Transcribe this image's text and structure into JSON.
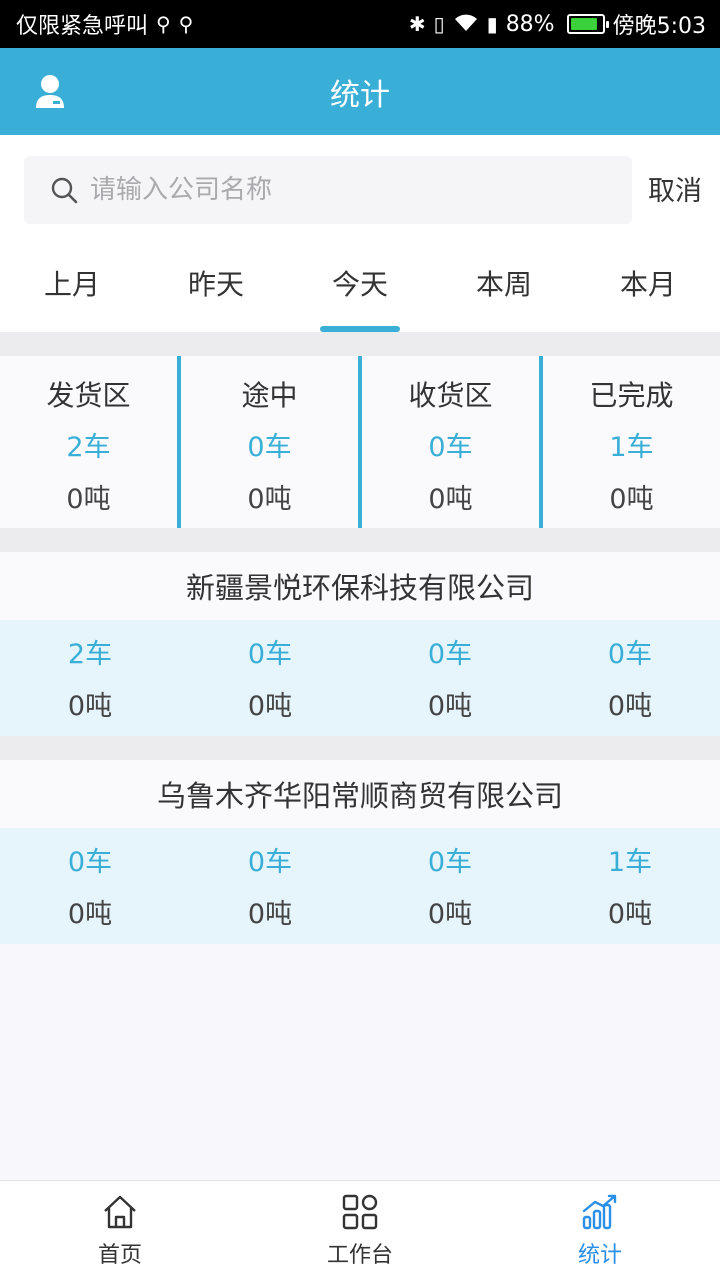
{
  "status_bar": {
    "left_text": "仅限紧急呼叫",
    "battery": "88%",
    "time": "傍晚5:03",
    "battery_level": 0.88
  },
  "header": {
    "title": "统计",
    "user_icon": "user-icon"
  },
  "search": {
    "placeholder": "请输入公司名称",
    "value": "",
    "cancel_label": "取消"
  },
  "tabs": [
    {
      "label": "上月",
      "active": false
    },
    {
      "label": "昨天",
      "active": false
    },
    {
      "label": "今天",
      "active": true
    },
    {
      "label": "本周",
      "active": false
    },
    {
      "label": "本月",
      "active": false
    }
  ],
  "summary": [
    {
      "label": "发货区",
      "cars": "2车",
      "tons": "0吨"
    },
    {
      "label": "途中",
      "cars": "0车",
      "tons": "0吨"
    },
    {
      "label": "收货区",
      "cars": "0车",
      "tons": "0吨"
    },
    {
      "label": "已完成",
      "cars": "1车",
      "tons": "0吨"
    }
  ],
  "companies": [
    {
      "name": "新疆景悦环保科技有限公司",
      "stats": [
        {
          "cars": "2车",
          "tons": "0吨"
        },
        {
          "cars": "0车",
          "tons": "0吨"
        },
        {
          "cars": "0车",
          "tons": "0吨"
        },
        {
          "cars": "0车",
          "tons": "0吨"
        }
      ]
    },
    {
      "name": "乌鲁木齐华阳常顺商贸有限公司",
      "stats": [
        {
          "cars": "0车",
          "tons": "0吨"
        },
        {
          "cars": "0车",
          "tons": "0吨"
        },
        {
          "cars": "0车",
          "tons": "0吨"
        },
        {
          "cars": "1车",
          "tons": "0吨"
        }
      ]
    }
  ],
  "bottom_nav": [
    {
      "label": "首页",
      "icon": "home-icon",
      "active": false
    },
    {
      "label": "工作台",
      "icon": "grid-icon",
      "active": false
    },
    {
      "label": "统计",
      "icon": "chart-icon",
      "active": true
    }
  ],
  "colors": {
    "accent": "#39afd7",
    "nav_active": "#2a8fe8",
    "company_stats_bg": "#e6f4fb"
  }
}
